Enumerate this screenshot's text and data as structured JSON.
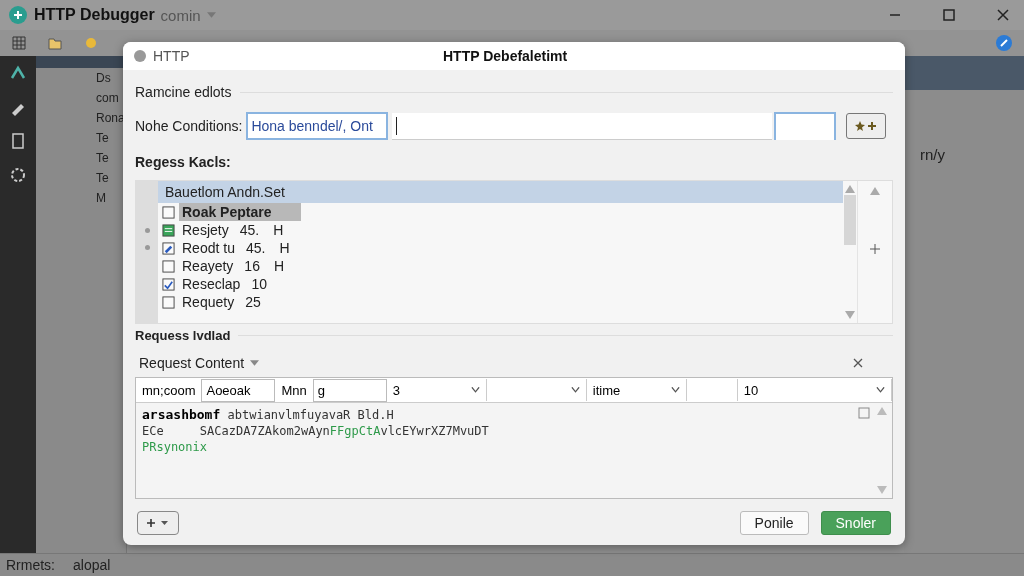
{
  "app": {
    "title": "HTTP Debugger",
    "subtitle": "comin"
  },
  "left_panel": {
    "items": [
      {
        "label": "Ds"
      },
      {
        "label": "com"
      },
      {
        "label": "Rona"
      },
      {
        "label": "Te"
      },
      {
        "label": "Te"
      },
      {
        "label": "Te"
      },
      {
        "label": "M"
      }
    ]
  },
  "right_panel": {
    "text": "rn/y"
  },
  "status_bar": {
    "label": "Rrmets:",
    "value": "alopal"
  },
  "dialog": {
    "app_name": "HTTP",
    "title": "HTTP Debefaletimt",
    "section": "Ramcine edlots",
    "condition_label": "Nohe Conditions:",
    "condition_value": "Hona benndel/, Ont",
    "rules_label": "Regess Kacls:",
    "rules": [
      {
        "label": "Bauetlom Andn.Set",
        "kind": "none",
        "selected": true,
        "highlighted": false
      },
      {
        "label": "Roak Peptare",
        "kind": "empty",
        "selected": false,
        "highlighted": true
      },
      {
        "label": "Resjety",
        "value": "45.",
        "suffix": "H",
        "kind": "sheet",
        "selected": false,
        "highlighted": false
      },
      {
        "label": "Reodt tu",
        "value": "45.",
        "suffix": "H",
        "kind": "edit",
        "selected": false,
        "highlighted": false
      },
      {
        "label": "Reayety",
        "value": "16",
        "suffix": "H",
        "kind": "empty",
        "selected": false,
        "highlighted": false
      },
      {
        "label": "Reseclap",
        "value": "10",
        "kind": "tick",
        "selected": false,
        "highlighted": false
      },
      {
        "label": "Requety",
        "value": "25",
        "kind": "empty",
        "selected": false,
        "highlighted": false
      }
    ],
    "request_label": "Requess lvdlad",
    "content_tab": "Request Content",
    "filters": [
      {
        "kind": "label",
        "text": "mn;coom"
      },
      {
        "kind": "input",
        "value": "Aoeoak"
      },
      {
        "kind": "label",
        "text": "Mnn"
      },
      {
        "kind": "input",
        "value": "g"
      },
      {
        "kind": "select",
        "value": "3"
      },
      {
        "kind": "select"
      },
      {
        "kind": "select",
        "value": "itime"
      },
      {
        "kind": "spacer"
      },
      {
        "kind": "select",
        "value": "10"
      }
    ],
    "body_lines": [
      [
        {
          "text": "arsashbomf",
          "kind": "bold"
        },
        {
          "text": " abtwianvlmfuyavaR Bld.H",
          "kind": "plain"
        }
      ],
      [
        {
          "text": "ECe     SACazDA7ZAkom2wAyn",
          "kind": "plain"
        },
        {
          "text": "FFgpCtA",
          "kind": "green"
        },
        {
          "text": "vlcEYwrXZ7MvuDT",
          "kind": "plain"
        }
      ],
      [
        {
          "text": "PRsynonix",
          "kind": "green"
        }
      ]
    ],
    "buttons": [
      {
        "label": "Ponile",
        "kind": "default"
      },
      {
        "label": "Snoler",
        "kind": "primary"
      }
    ]
  }
}
